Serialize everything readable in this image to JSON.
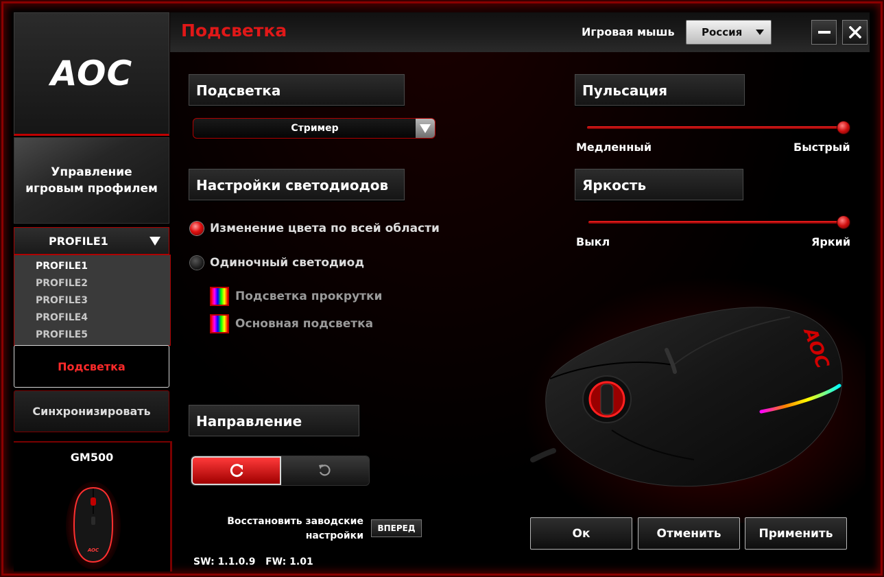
{
  "sidebar": {
    "logo": "AOC",
    "profile_management": "Управление игровым профилем",
    "profile_selected": "PROFILE1",
    "profiles": [
      "PROFILE1",
      "PROFILE2",
      "PROFILE3",
      "PROFILE4",
      "PROFILE5"
    ],
    "nav_lighting": "Подсветка",
    "nav_sync": "Синхронизировать",
    "device_name": "GM500",
    "device_logo": "AOC"
  },
  "header": {
    "title": "Подсветка",
    "mouse_type_label": "Игровая мышь",
    "language": "Россия"
  },
  "lighting": {
    "section_title": "Подсветка",
    "effect": "Стример"
  },
  "led_settings": {
    "section_title": "Настройки светодиодов",
    "option_all": "Изменение цвета по всей области",
    "option_single": "Одиночный светодиод",
    "selected_option": "option_all",
    "zone_scroll": "Подсветка прокрутки",
    "zone_main": "Основная подсветка"
  },
  "direction": {
    "section_title": "Направление",
    "selected": "clockwise"
  },
  "pulse": {
    "section_title": "Пульсация",
    "min_label": "Медленный",
    "max_label": "Быстрый",
    "value_fraction": 1.0
  },
  "brightness": {
    "section_title": "Яркость",
    "min_label": "Выкл",
    "max_label": "Яркий",
    "value_fraction": 1.0
  },
  "footer": {
    "reset_label_line1": "Восстановить заводские",
    "reset_label_line2": "настройки",
    "reset_button": "ВПЕРЕД",
    "version": "SW: 1.1.0.9   FW: 1.01",
    "ok": "Ок",
    "cancel": "Отменить",
    "apply": "Применить"
  },
  "colors": {
    "accent_red": "#e01818",
    "border_red": "#b00000"
  }
}
